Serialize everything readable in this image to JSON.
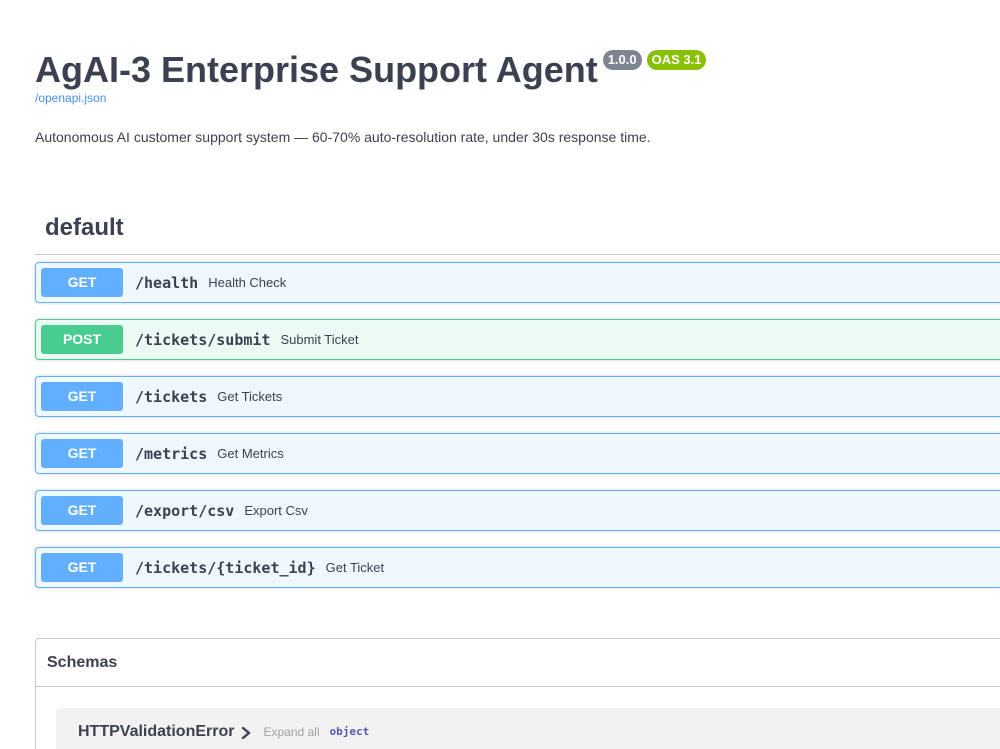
{
  "info": {
    "title": "AgAI-3 Enterprise Support Agent",
    "version": "1.0.0",
    "oas_version": "OAS 3.1",
    "spec_link": "/openapi.json",
    "description": "Autonomous AI customer support system — 60-70% auto-resolution rate, under 30s response time."
  },
  "tag": {
    "name": "default"
  },
  "operations": [
    {
      "method": "GET",
      "path": "/health",
      "summary": "Health Check"
    },
    {
      "method": "POST",
      "path": "/tickets/submit",
      "summary": "Submit Ticket"
    },
    {
      "method": "GET",
      "path": "/tickets",
      "summary": "Get Tickets"
    },
    {
      "method": "GET",
      "path": "/metrics",
      "summary": "Get Metrics"
    },
    {
      "method": "GET",
      "path": "/export/csv",
      "summary": "Export Csv"
    },
    {
      "method": "GET",
      "path": "/tickets/{ticket_id}",
      "summary": "Get Ticket"
    }
  ],
  "schemas": {
    "title": "Schemas",
    "models": [
      {
        "name": "HTTPValidationError",
        "expand_label": "Expand all",
        "type": "object"
      }
    ]
  },
  "colors": {
    "get": "#61affe",
    "post": "#49cc90",
    "badge_version": "#7d8492",
    "badge_oas": "#89bf04",
    "link": "#4990e2"
  },
  "icons": {
    "model_toggle": "chevron-right-icon"
  }
}
